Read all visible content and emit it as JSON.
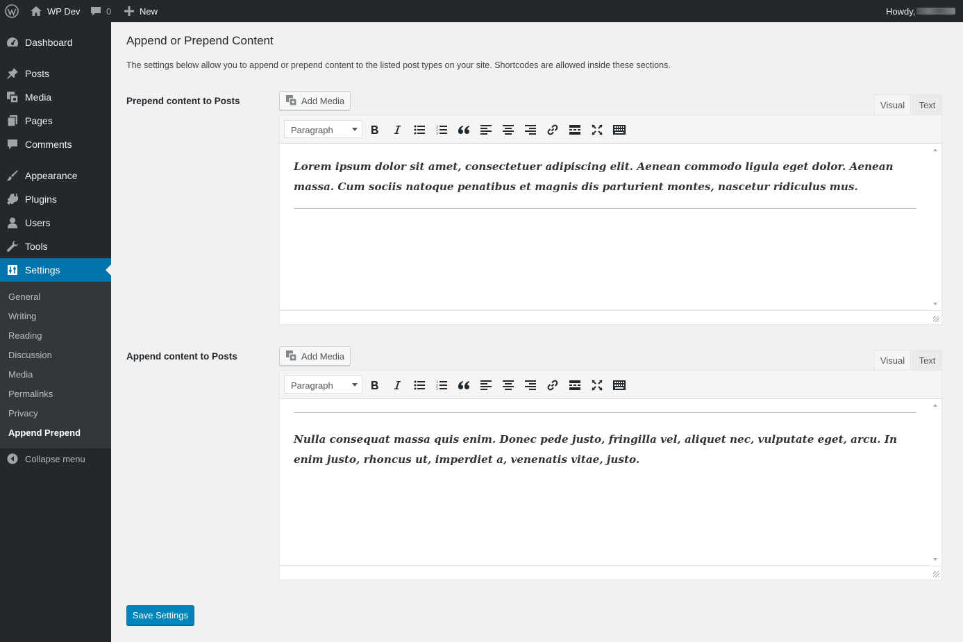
{
  "adminbar": {
    "site_name": "WP Dev",
    "comments_count": "0",
    "new_label": "New",
    "howdy": "Howdy,"
  },
  "sidebar": {
    "items": [
      {
        "label": "Dashboard",
        "icon": "dashboard-icon"
      },
      {
        "label": "Posts",
        "icon": "pin-icon"
      },
      {
        "label": "Media",
        "icon": "media-icon"
      },
      {
        "label": "Pages",
        "icon": "pages-icon"
      },
      {
        "label": "Comments",
        "icon": "comments-icon"
      },
      {
        "label": "Appearance",
        "icon": "brush-icon"
      },
      {
        "label": "Plugins",
        "icon": "plugin-icon"
      },
      {
        "label": "Users",
        "icon": "users-icon"
      },
      {
        "label": "Tools",
        "icon": "wrench-icon"
      },
      {
        "label": "Settings",
        "icon": "settings-icon"
      }
    ],
    "submenu": [
      "General",
      "Writing",
      "Reading",
      "Discussion",
      "Media",
      "Permalinks",
      "Privacy",
      "Append Prepend"
    ],
    "collapse_label": "Collapse menu"
  },
  "main": {
    "title": "Append or Prepend Content",
    "description": "The settings below allow you to append or prepend content to the listed post types on your site. Shortcodes are allowed inside these sections.",
    "sections": [
      {
        "label": "Prepend content to Posts",
        "add_media": "Add Media",
        "format": "Paragraph",
        "tab_visual": "Visual",
        "tab_text": "Text",
        "content": "Lorem ipsum dolor sit amet, consectetuer adipiscing elit. Aenean commodo ligula eget dolor. Aenean massa. Cum sociis natoque penatibus et magnis dis parturient montes, nascetur ridiculus mus."
      },
      {
        "label": "Append content to Posts",
        "add_media": "Add Media",
        "format": "Paragraph",
        "tab_visual": "Visual",
        "tab_text": "Text",
        "content": "Nulla consequat massa quis enim. Donec pede justo, fringilla vel, aliquet nec, vulputate eget, arcu. In enim justo, rhoncus ut, imperdiet a, venenatis vitae, justo."
      }
    ],
    "save_label": "Save Settings"
  },
  "colors": {
    "admin_dark": "#23282d",
    "submenu_bg": "#32373c",
    "accent": "#0073aa",
    "button_primary": "#0085ba",
    "page_bg": "#f1f1f1"
  }
}
